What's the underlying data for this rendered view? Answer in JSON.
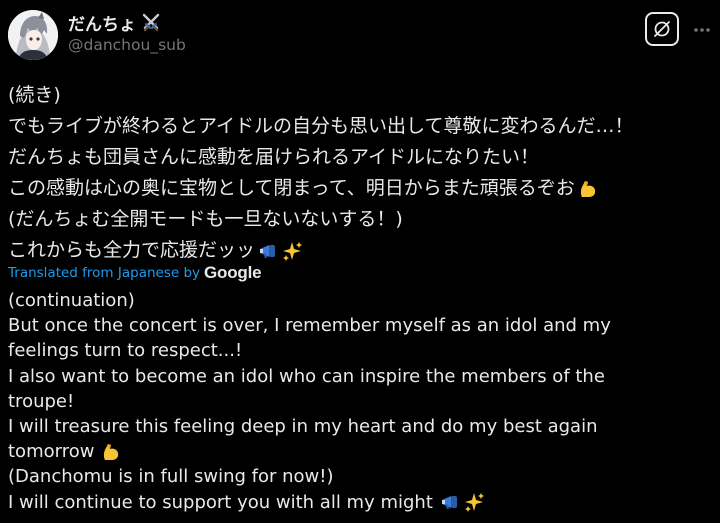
{
  "header": {
    "display_name": "だんちょ",
    "name_emoji": "crossed-swords-icon",
    "handle": "@danchou_sub"
  },
  "actions": {
    "grok_icon": "grok-icon",
    "more_icon": "more-icon"
  },
  "japanese_lines": [
    "(続き)",
    "でもライブが終わるとアイドルの自分も思い出して尊敬に変わるんだ…！",
    "だんちょも団員さんに感動を届けられるアイドルになりたい！",
    "この感動は心の奥に宝物として閉まって、明日からまた頑張るぞお",
    "(だんちょむ全開モードも一旦ないないする！)",
    "これからも全力で応援だッッ"
  ],
  "translation": {
    "label": "Translated from Japanese by",
    "provider": "Google"
  },
  "english_lines": [
    "(continuation)",
    "But once the concert is over, I remember myself as an idol and my",
    "feelings turn to respect...!",
    "I also want to become an idol who can inspire the members of the",
    "troupe!",
    "I will treasure this feeling deep in my heart and do my best again",
    "tomorrow",
    "(Danchomu is in full swing for now!)",
    "I will continue to support you with all my might"
  ],
  "colors": {
    "background": "#000000",
    "text": "#e7e9ea",
    "muted": "#71767b",
    "link": "#1d9bf0"
  }
}
